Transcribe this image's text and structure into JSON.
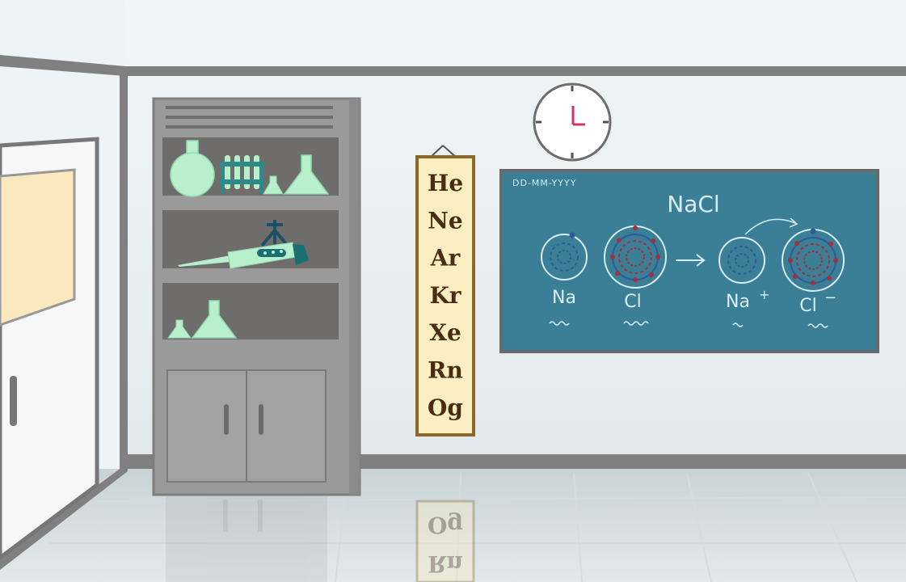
{
  "scene": "chemistry-lab",
  "noble_gas_scroll": {
    "elements": [
      "He",
      "Ne",
      "Ar",
      "Kr",
      "Xe",
      "Rn",
      "Og"
    ],
    "reflection": [
      "Og",
      "Rn"
    ]
  },
  "chalkboard": {
    "date_placeholder": "DD-MM-YYYY",
    "title": "NaCl",
    "atoms": [
      {
        "label": "Na",
        "charge": ""
      },
      {
        "label": "Cl",
        "charge": ""
      },
      {
        "label": "Na",
        "charge": "+"
      },
      {
        "label": "Cl",
        "charge": "−"
      }
    ]
  },
  "colors": {
    "wall": "#e9eef0",
    "trim": "#7f7f7f",
    "cabinet": "#9a9a9a",
    "shelf_inside": "#6f6c6c",
    "glassware": "#b8efcc",
    "board": "#3a7f96",
    "scroll": "#fbefc2",
    "scroll_border": "#8a6a2c",
    "clock_hands": "#cc3366"
  }
}
